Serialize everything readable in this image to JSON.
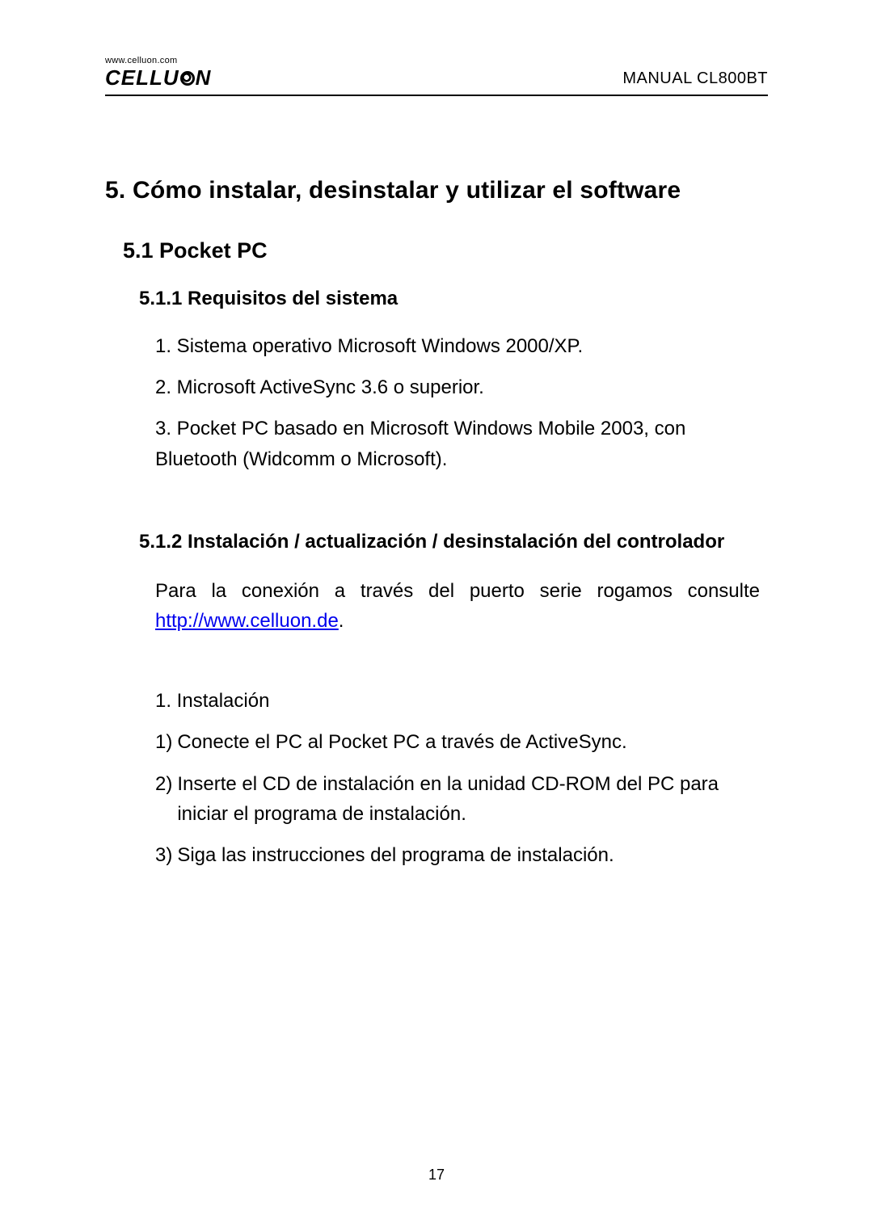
{
  "header": {
    "logo_url": "www.celluon.com",
    "logo_text_pre": "CELLU",
    "logo_text_post": "N",
    "manual_label": "MANUAL CL800BT"
  },
  "content": {
    "h1": "5. Cómo instalar, desinstalar y utilizar el software",
    "h2": "5.1 Pocket PC",
    "section_511": {
      "title": "5.1.1 Requisitos del sistema",
      "items": [
        "1. Sistema operativo Microsoft Windows 2000/XP.",
        "2. Microsoft ActiveSync 3.6 o superior.",
        "3. Pocket PC basado en Microsoft Windows Mobile 2003, con Bluetooth (Widcomm o Microsoft)."
      ]
    },
    "section_512": {
      "title": "5.1.2 Instalación / actualización / desinstalación del controlador",
      "intro_pre": "Para la conexión a través del puerto serie rogamos consulte ",
      "intro_link": "http://www.celluon.de",
      "intro_post": ".",
      "subhead": "1. Instalación",
      "steps": [
        {
          "n": "1)",
          "t": "Conecte el PC al Pocket PC a través de ActiveSync."
        },
        {
          "n": "2)",
          "t": "Inserte el CD de instalación en la unidad CD-ROM del PC para iniciar el programa de instalación."
        },
        {
          "n": "3)",
          "t": "Siga las instrucciones del programa de instalación."
        }
      ]
    }
  },
  "page_number": "17"
}
